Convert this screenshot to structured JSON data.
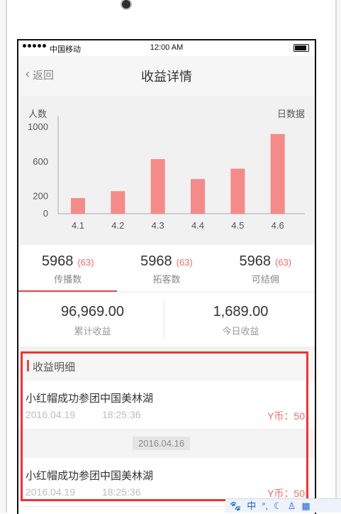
{
  "status_bar": {
    "carrier": "中国移动",
    "time": "12:00 AM"
  },
  "header": {
    "back_label": "返回",
    "title": "收益详情"
  },
  "chart_data": {
    "type": "bar",
    "ylabel": "人数",
    "legend_note": "日数据",
    "categories": [
      "4.1",
      "4.2",
      "4.3",
      "4.4",
      "4.5",
      "4.6"
    ],
    "values": [
      180,
      260,
      630,
      400,
      520,
      920
    ],
    "yticks": [
      0,
      200,
      600,
      1000
    ],
    "ylim": [
      0,
      1000
    ],
    "bar_color": "#f58a8a",
    "grid": false
  },
  "stats": [
    {
      "value": "5968",
      "count": "(63)",
      "label": "传播数",
      "active": true
    },
    {
      "value": "5968",
      "count": "(63)",
      "label": "拓客数",
      "active": false
    },
    {
      "value": "5968",
      "count": "(63)",
      "label": "可结佣",
      "active": false
    }
  ],
  "totals": [
    {
      "value": "96,969.00",
      "label": "累计收益"
    },
    {
      "value": "1,689.00",
      "label": "今日收益"
    }
  ],
  "details": {
    "title": "收益明细",
    "items": [
      {
        "title": "小红帽成功参团中国美林湖",
        "date": "2016.04.19",
        "time": "18:25:36",
        "coins": "Y币：50"
      },
      {
        "title": "小红帽成功参团中国美林湖",
        "date": "2016.04.19",
        "time": "18:25:36",
        "coins": "Y币：50"
      }
    ],
    "divider_date": "2016.04.16"
  },
  "ime": {
    "chars": [
      "中",
      "°,",
      "☾",
      "♙",
      "▦"
    ]
  },
  "colors": {
    "accent": "#e04848",
    "bar": "#f58a8a",
    "highlight": "#ee3333"
  }
}
